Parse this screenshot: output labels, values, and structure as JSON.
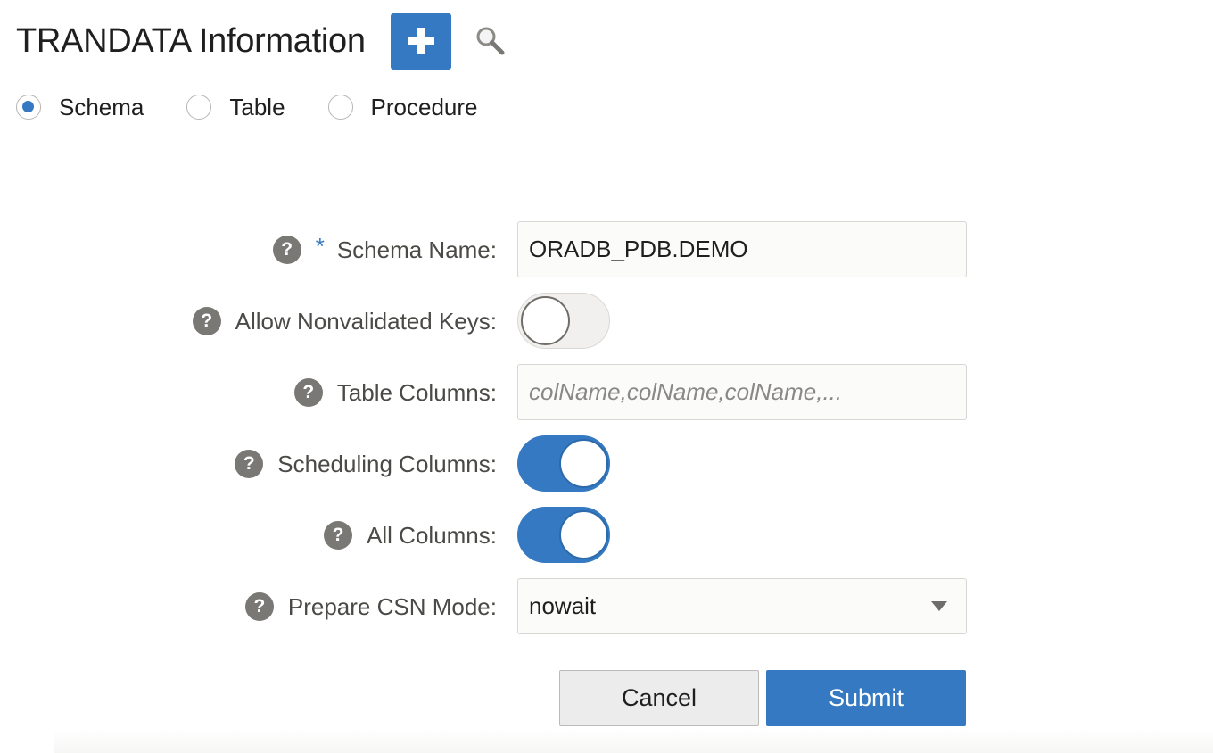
{
  "header": {
    "title": "TRANDATA Information",
    "add_icon": "plus-icon",
    "search_icon": "search-icon",
    "accent_color": "#3479c1"
  },
  "radios": [
    {
      "label": "Schema",
      "checked": true
    },
    {
      "label": "Table",
      "checked": false
    },
    {
      "label": "Procedure",
      "checked": false
    }
  ],
  "form": {
    "schema_name": {
      "label": "Schema Name:",
      "required_mark": "*",
      "value": "ORADB_PDB.DEMO"
    },
    "allow_nonvalidated_keys": {
      "label": "Allow Nonvalidated Keys:",
      "on": false
    },
    "table_columns": {
      "label": "Table Columns:",
      "value": "",
      "placeholder": "colName,colName,colName,..."
    },
    "scheduling_columns": {
      "label": "Scheduling Columns:",
      "on": true
    },
    "all_columns": {
      "label": "All Columns:",
      "on": true
    },
    "prepare_csn_mode": {
      "label": "Prepare CSN Mode:",
      "value": "nowait"
    },
    "help_glyph": "?"
  },
  "buttons": {
    "cancel": "Cancel",
    "submit": "Submit"
  }
}
